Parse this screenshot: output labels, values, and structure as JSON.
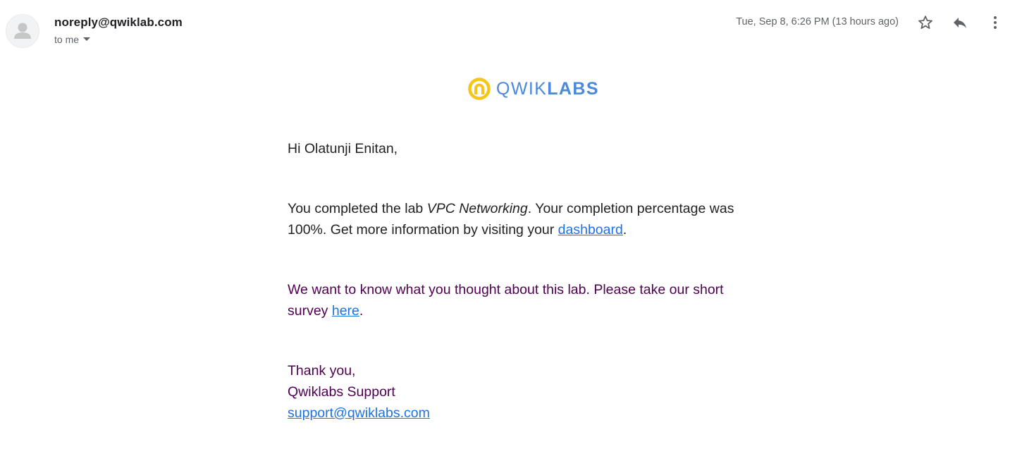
{
  "header": {
    "sender": "noreply@qwiklab.com",
    "recipient": "to me",
    "timestamp": "Tue, Sep 8, 6:26 PM (13 hours ago)",
    "icons": {
      "avatar": "person-icon",
      "caret": "caret-down-icon",
      "star": "star-icon",
      "reply": "reply-icon",
      "more": "more-vert-icon"
    }
  },
  "logo": {
    "text_light": "QWIK",
    "text_bold": "LABS",
    "mark_color": "#f5c518",
    "text_color": "#4a89dc"
  },
  "body": {
    "greeting": "Hi Olatunji Enitan,",
    "completion": {
      "before_lab": "You completed the lab ",
      "lab_name": "VPC Networking",
      "after_lab": ". Your completion percentage was 100%. Get more information by visiting your ",
      "dashboard_link": "dashboard",
      "end": "."
    },
    "survey": {
      "text": "We want to know what you thought about this lab. Please take our short survey ",
      "link": "here",
      "end": "."
    },
    "signoff": {
      "thanks": "Thank you,",
      "team": "Qwiklabs Support",
      "email_link": "support@qwiklabs.com"
    }
  },
  "colors": {
    "link": "#1a73e8",
    "quoted_text": "#500050",
    "meta_text": "#5f6368"
  }
}
